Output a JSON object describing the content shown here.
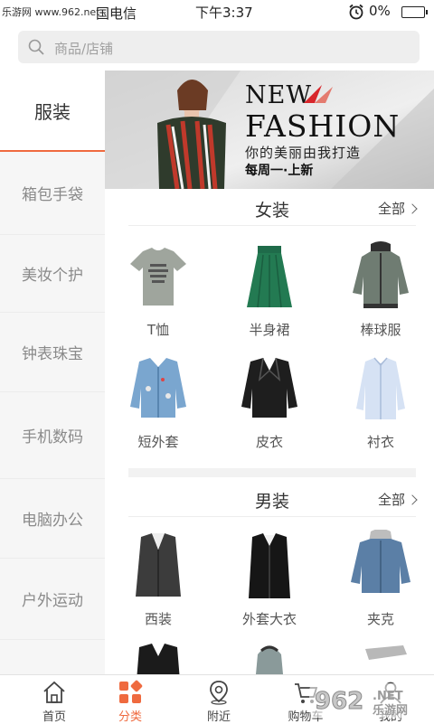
{
  "status": {
    "watermark": "乐游网 www.962.net",
    "carrier": "国电信",
    "time": "下午3:37",
    "battery": "0%"
  },
  "search": {
    "placeholder": "商品/店铺"
  },
  "sidebar": {
    "items": [
      {
        "label": "服装",
        "active": true
      },
      {
        "label": "箱包手袋"
      },
      {
        "label": "美妆个护"
      },
      {
        "label": "钟表珠宝"
      },
      {
        "label": "手机数码"
      },
      {
        "label": "电脑办公"
      },
      {
        "label": "户外运动"
      }
    ]
  },
  "banner": {
    "headline_1": "NEW",
    "headline_2": "FASHION",
    "tagline": "你的美丽由我打造",
    "sub": "每周一·上新"
  },
  "sections": [
    {
      "title": "女装",
      "all_label": "全部",
      "items": [
        {
          "label": "T恤"
        },
        {
          "label": "半身裙"
        },
        {
          "label": "棒球服"
        },
        {
          "label": "短外套"
        },
        {
          "label": "皮衣"
        },
        {
          "label": "衬衣"
        }
      ]
    },
    {
      "title": "男装",
      "all_label": "全部",
      "items": [
        {
          "label": "西装"
        },
        {
          "label": "外套大衣"
        },
        {
          "label": "夹克"
        }
      ]
    }
  ],
  "tabbar": {
    "items": [
      {
        "label": "首页",
        "icon": "home-icon"
      },
      {
        "label": "分类",
        "icon": "category-icon",
        "active": true
      },
      {
        "label": "附近",
        "icon": "location-icon"
      },
      {
        "label": "购物车",
        "icon": "cart-icon"
      },
      {
        "label": "我的",
        "icon": "user-icon"
      }
    ]
  },
  "overlay_logo": "962.NET 乐游网",
  "colors": {
    "accent": "#ef6a3f",
    "sidebar_bg": "#f6f6f6",
    "search_bg": "#eeeeee"
  }
}
